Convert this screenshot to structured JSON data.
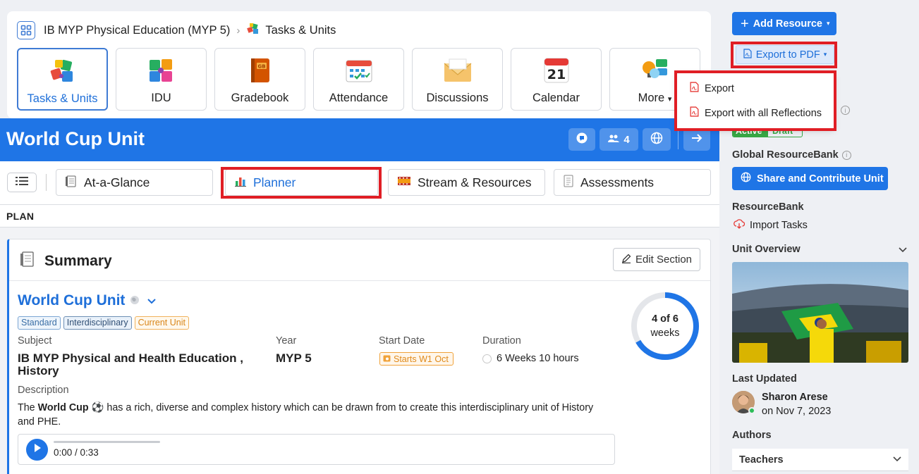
{
  "breadcrumb": {
    "course": "IB MYP Physical Education (MYP 5)",
    "current": "Tasks & Units"
  },
  "tiles": [
    {
      "label": "Tasks & Units",
      "icon": "puzzle-icon"
    },
    {
      "label": "IDU",
      "icon": "idu-puzzle-icon"
    },
    {
      "label": "Gradebook",
      "icon": "gradebook-icon"
    },
    {
      "label": "Attendance",
      "icon": "attendance-icon"
    },
    {
      "label": "Discussions",
      "icon": "envelope-icon"
    },
    {
      "label": "Calendar",
      "icon": "calendar-icon",
      "day": "21"
    },
    {
      "label": "More",
      "icon": "more-apps-icon"
    }
  ],
  "banner": {
    "title": "World Cup Unit",
    "members_count": "4"
  },
  "tabs": [
    {
      "label": "At-a-Glance"
    },
    {
      "label": "Planner"
    },
    {
      "label": "Stream & Resources"
    },
    {
      "label": "Assessments"
    }
  ],
  "plan_label": "PLAN",
  "summary": {
    "heading": "Summary",
    "edit_label": "Edit Section",
    "unit_title": "World Cup Unit",
    "tags": [
      "Standard",
      "Interdisciplinary",
      "Current Unit"
    ],
    "subject_label": "Subject",
    "subject_line1": "IB MYP Physical and Health Education ,",
    "subject_line2": "History",
    "year_label": "Year",
    "year_value": "MYP 5",
    "start_label": "Start Date",
    "start_value": "Starts W1 Oct",
    "duration_label": "Duration",
    "duration_value": "6 Weeks 10 hours",
    "progress_main": "4 of 6",
    "progress_unit": "weeks",
    "progress_fraction": 0.6667,
    "description_label": "Description",
    "description_pre": "The ",
    "description_bold": "World Cup",
    "description_post": " has a rich, diverse and complex history which can be drawn from to create this interdisciplinary unit of History and PHE.",
    "audio_time": "0:00 / 0:33"
  },
  "right_panel": {
    "add_resource": "Add Resource",
    "export_pdf": "Export to PDF",
    "export_options": [
      "Export",
      "Export with all Reflections"
    ],
    "status_active": "Active",
    "status_draft": "Draft",
    "global_resourcebank_label": "Global ResourceBank",
    "share_contribute": "Share and Contribute Unit",
    "resourcebank_label": "ResourceBank",
    "import_tasks": "Import Tasks",
    "unit_overview_label": "Unit Overview",
    "last_updated_label": "Last Updated",
    "updated_by": "Sharon Arese",
    "updated_on": "on Nov 7, 2023",
    "authors_label": "Authors",
    "teachers_label": "Teachers"
  },
  "colors": {
    "primary": "#1f75e6",
    "highlight": "#e01e25",
    "success": "#38a845",
    "warning": "#f0a23a"
  }
}
